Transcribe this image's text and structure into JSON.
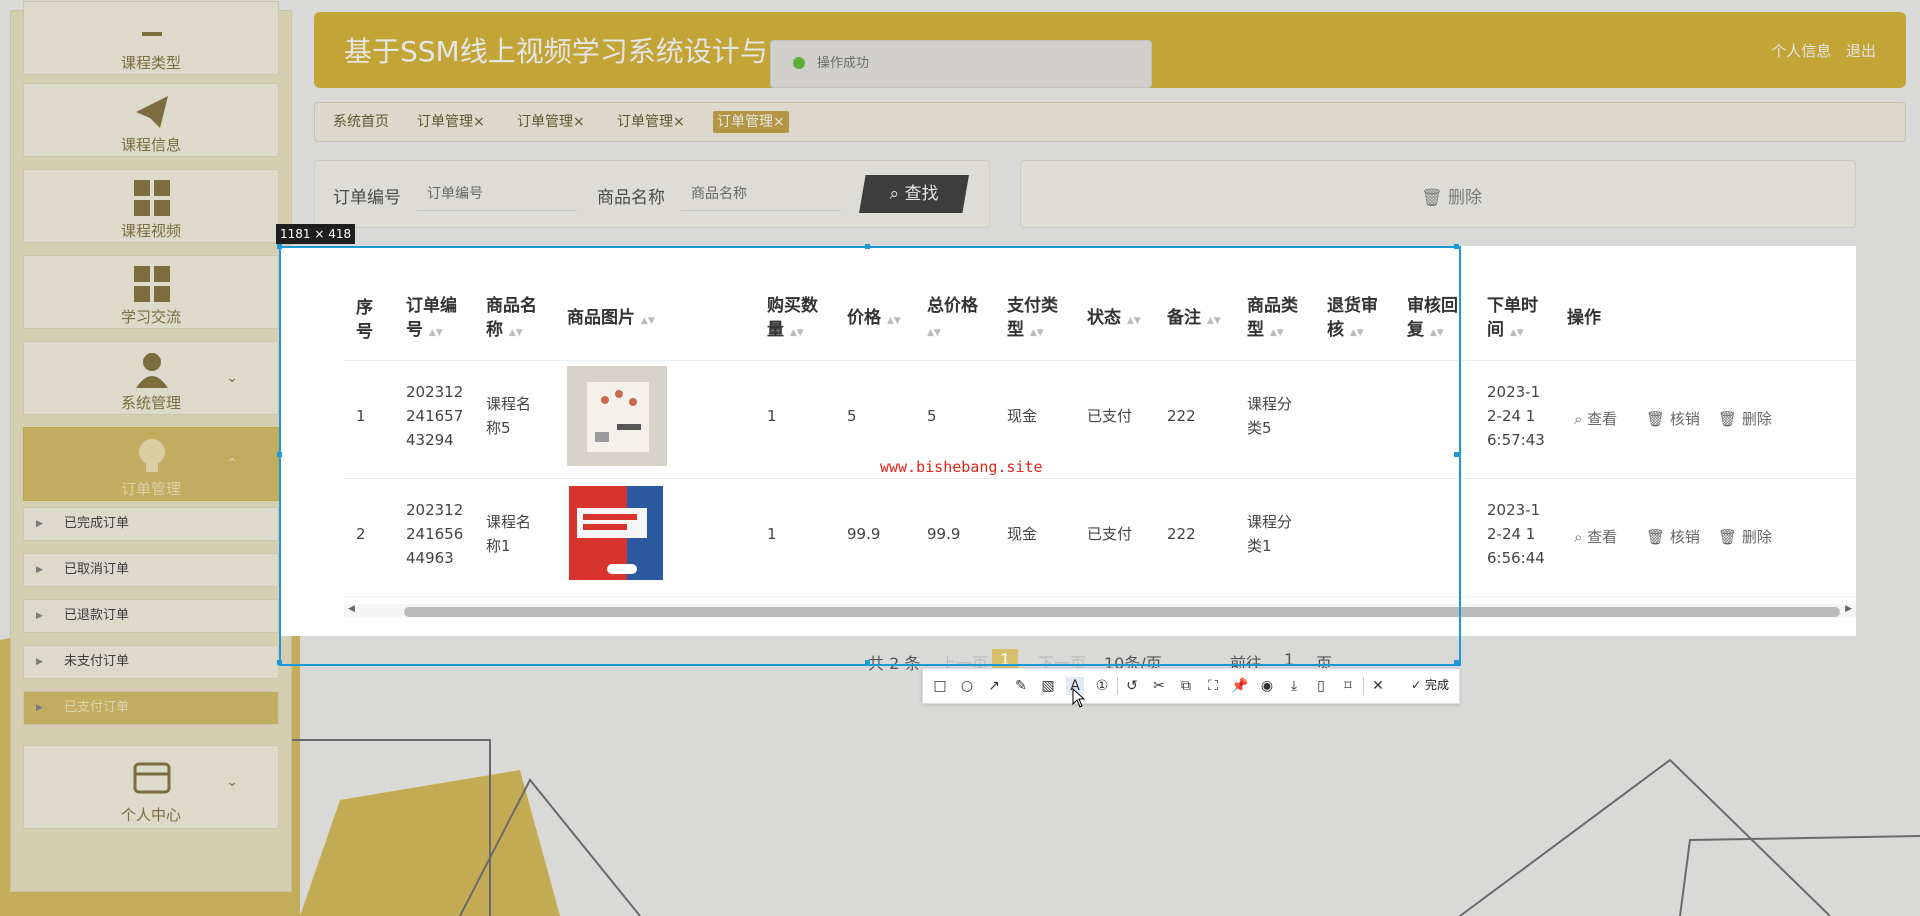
{
  "app_title": "基于SSM线上视频学习系统设计与",
  "header": {
    "profile_link": "个人信息",
    "logout_link": "退出"
  },
  "toast": {
    "message": "操作成功"
  },
  "sidebar": {
    "items": [
      {
        "label": "课程类型",
        "icon": "dash-icon"
      },
      {
        "label": "课程信息",
        "icon": "paper-plane-icon"
      },
      {
        "label": "课程视频",
        "icon": "grid-icon"
      },
      {
        "label": "学习交流",
        "icon": "grid-icon"
      },
      {
        "label": "系统管理",
        "icon": "user-icon"
      },
      {
        "label": "订单管理",
        "icon": "lightbulb-icon"
      }
    ],
    "order_sub": [
      "已完成订单",
      "已取消订单",
      "已退款订单",
      "未支付订单",
      "已支付订单"
    ],
    "personal": {
      "label": "个人中心",
      "icon": "card-icon"
    }
  },
  "tabs": [
    "系统首页",
    "订单管理",
    "订单管理",
    "订单管理",
    "订单管理"
  ],
  "tab_close": "×",
  "search": {
    "order_no_label": "订单编号",
    "order_no_placeholder": "订单编号",
    "product_label": "商品名称",
    "product_placeholder": "商品名称",
    "search_button": "查找"
  },
  "actions": {
    "delete": "删除"
  },
  "table": {
    "headers": [
      "序号",
      "订单编号",
      "商品名称",
      "商品图片",
      "购买数量",
      "价格",
      "总价格",
      "支付类型",
      "状态",
      "备注",
      "商品类型",
      "退货审核",
      "审核回复",
      "下单时间",
      "操作"
    ],
    "rows": [
      {
        "index": "1",
        "order_no": "20231224165743294",
        "product": "课程名称5",
        "qty": "1",
        "price": "5",
        "total": "5",
        "pay_type": "现金",
        "status": "已支付",
        "remark": "222",
        "type": "课程分类5",
        "refund_audit": "",
        "audit_reply": "",
        "time": "2023-12-24 16:57:43"
      },
      {
        "index": "2",
        "order_no": "20231224165644963",
        "product": "课程名称1",
        "qty": "1",
        "price": "99.9",
        "total": "99.9",
        "pay_type": "现金",
        "status": "已支付",
        "remark": "222",
        "type": "课程分类1",
        "refund_audit": "",
        "audit_reply": "",
        "time": "2023-12-24 16:56:44"
      }
    ],
    "row_ops": [
      "查看",
      "核销",
      "删除"
    ]
  },
  "pagination": {
    "total": "共 2 条",
    "prev": "上一页",
    "page": "1",
    "next": "下一页",
    "page_size": "10条/页",
    "goto": "前往",
    "goto_value": "1",
    "page_unit": "页"
  },
  "capture": {
    "size_label": "1181 × 418",
    "watermark": "www.bishebang.site",
    "done": "完成",
    "accent": "#1a9ad6"
  },
  "colors": {
    "brand": "#d8b73e",
    "active_nav": "#d8c06a"
  }
}
